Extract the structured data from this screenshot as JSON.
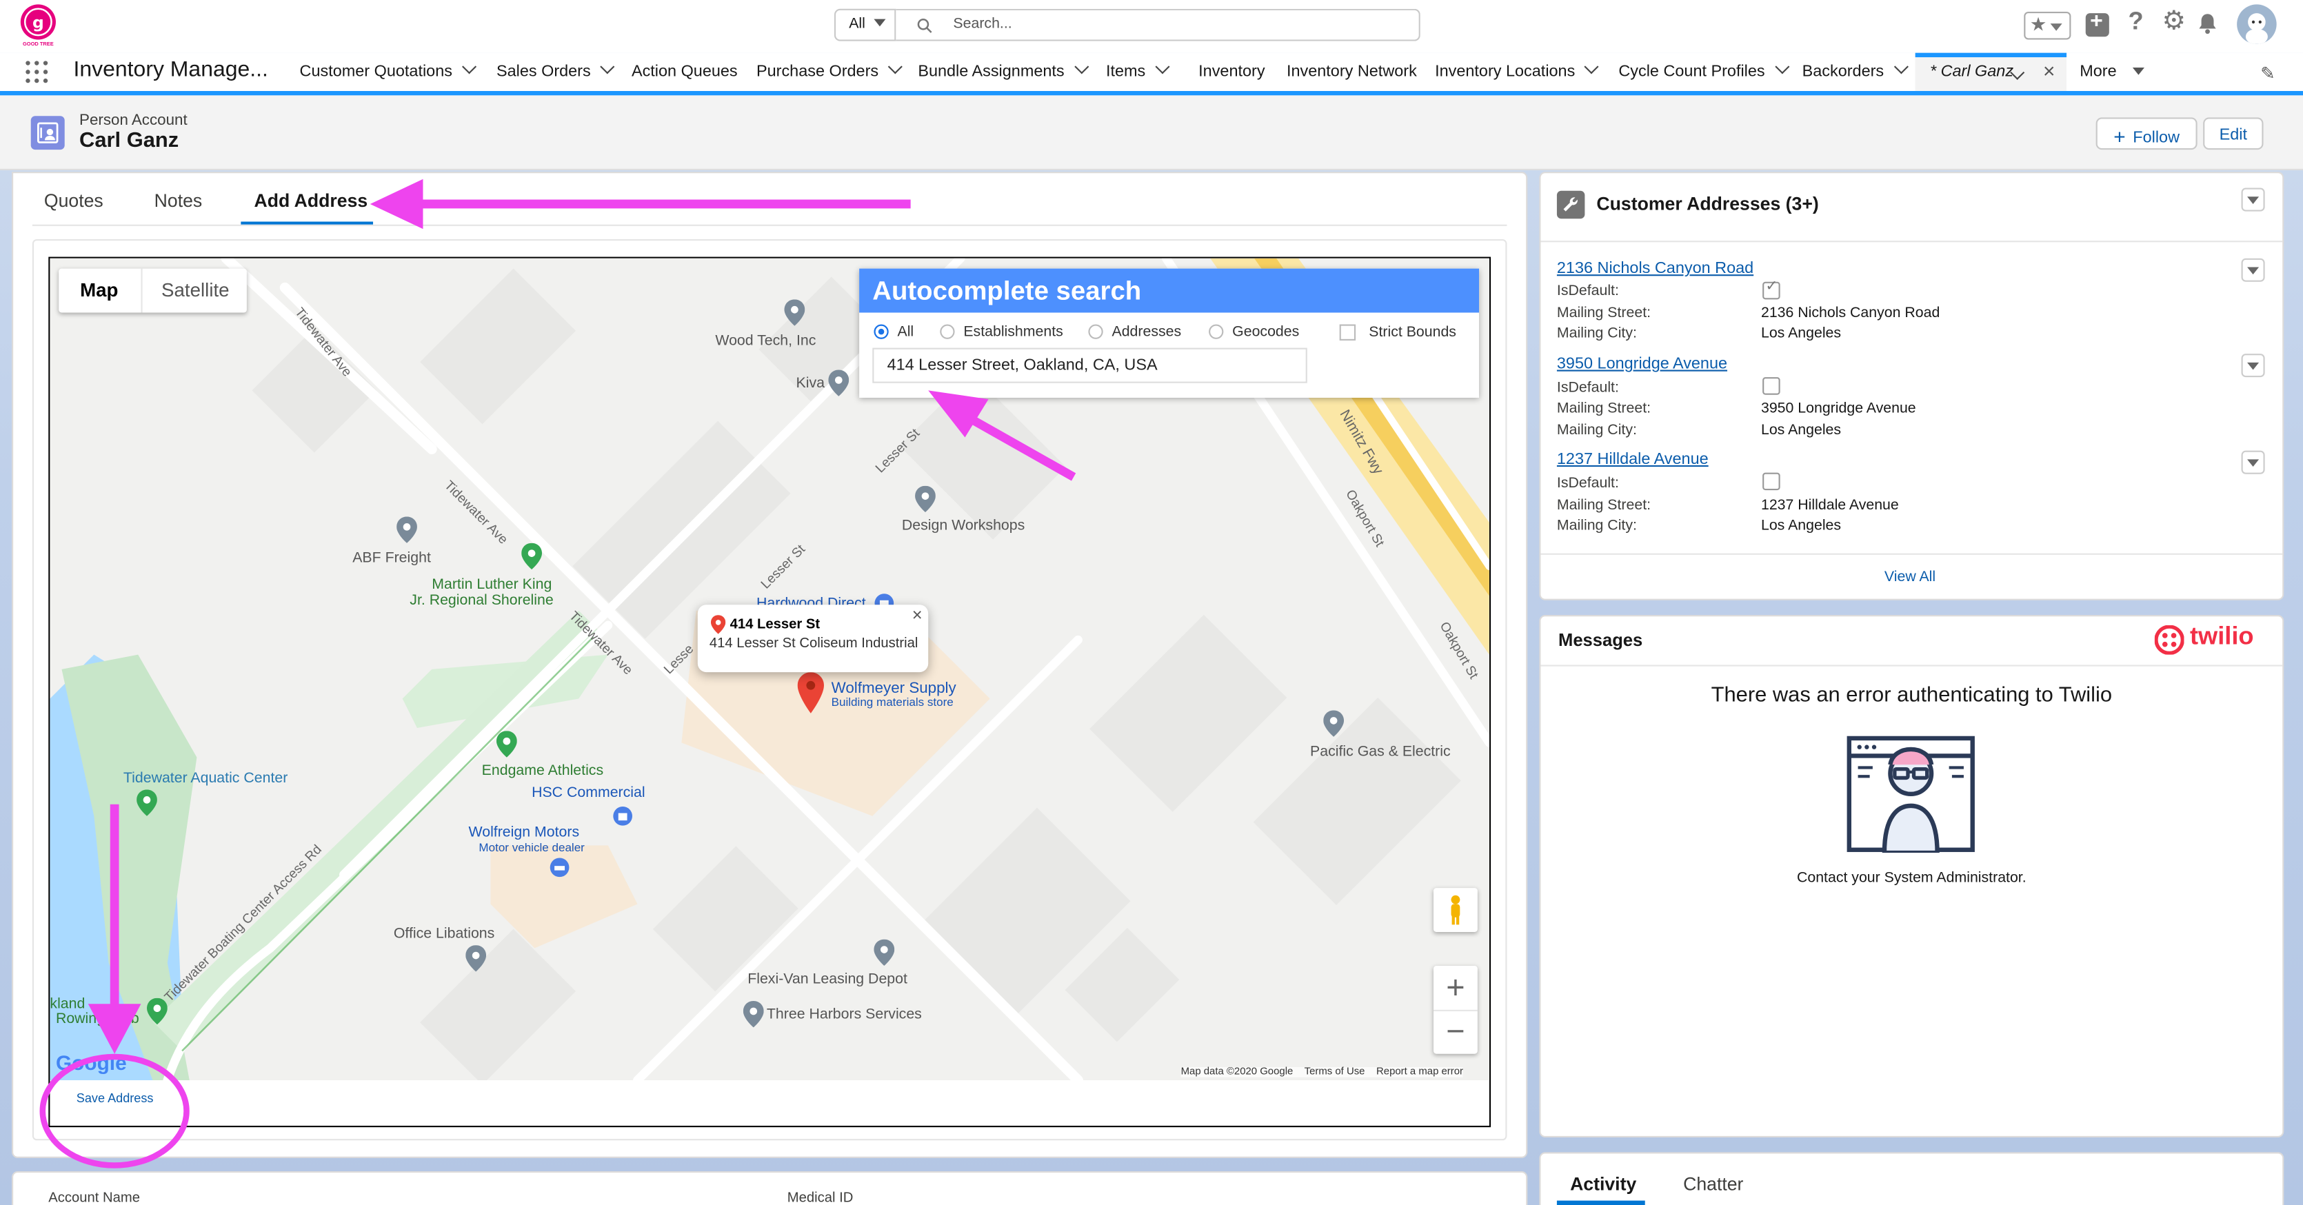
{
  "header": {
    "search_scope": "All",
    "search_placeholder": "Search...",
    "app_name": "Inventory Manage...",
    "logo_text": "GOOD TREE"
  },
  "nav": {
    "items": [
      {
        "label": "Customer Quotations",
        "dropdown": true
      },
      {
        "label": "Sales Orders",
        "dropdown": true
      },
      {
        "label": "Action Queues",
        "dropdown": false
      },
      {
        "label": "Purchase Orders",
        "dropdown": true
      },
      {
        "label": "Bundle Assignments",
        "dropdown": true
      },
      {
        "label": "Items",
        "dropdown": true
      },
      {
        "label": "Inventory",
        "dropdown": false
      },
      {
        "label": "Inventory Network",
        "dropdown": false
      },
      {
        "label": "Inventory Locations",
        "dropdown": true
      },
      {
        "label": "Cycle Count Profiles",
        "dropdown": true
      },
      {
        "label": "Backorders",
        "dropdown": true
      }
    ],
    "active_tab": "* Carl Ganz",
    "more": "More"
  },
  "record": {
    "object_type": "Person Account",
    "name": "Carl Ganz",
    "follow_label": "Follow",
    "edit_label": "Edit"
  },
  "tabs": {
    "quotes": "Quotes",
    "notes": "Notes",
    "add_address": "Add Address"
  },
  "map": {
    "map_btn": "Map",
    "satellite_btn": "Satellite",
    "autocomplete": {
      "title": "Autocomplete search",
      "options": [
        "All",
        "Establishments",
        "Addresses",
        "Geocodes"
      ],
      "selected": "All",
      "strict_bounds": "Strict Bounds",
      "value": "414 Lesser Street, Oakland, CA, USA"
    },
    "infowindow": {
      "title": "414 Lesser St",
      "subtitle": "414 Lesser St Coliseum Industrial"
    },
    "pois": {
      "wood_tech": "Wood Tech, Inc",
      "kiva": "Kiva",
      "design_workshops": "Design Workshops",
      "abf": "ABF Freight",
      "mlk": "Martin Luther King",
      "mlk2": "Jr. Regional Shoreline",
      "hardwood": "Hardwood Direct",
      "wolfmeyer": "Wolfmeyer Supply",
      "wolfmeyer_sub": "Building materials store",
      "pge": "Pacific Gas & Electric",
      "tidewater": "Tidewater Aquatic Center",
      "endgame": "Endgame Athletics",
      "hsc": "HSC Commercial",
      "wolfreign": "Wolfreign Motors",
      "wolfreign_sub": "Motor vehicle dealer",
      "office": "Office Libations",
      "flexivan": "Flexi-Van Leasing Depot",
      "three_harbors": "Three Harbors Services",
      "kland": "kland",
      "rowing": "Rowing Club"
    },
    "streets": {
      "tidewater1": "Tidewater Ave",
      "tidewater2": "Tidewater Ave",
      "tidewater3": "Tidewater Ave",
      "lesser1": "Lesser St",
      "lesser2": "Lesser St",
      "lesser3": "Lesse",
      "nimitz": "Nimitz Fwy",
      "oakport1": "Oakport St",
      "oakport2": "Oakport St",
      "boating": "Tidewater Boating Center Access Rd"
    },
    "footer": {
      "data": "Map data ©2020 Google",
      "terms": "Terms of Use",
      "report": "Report a map error"
    },
    "google": "Google"
  },
  "save_address": "Save Address",
  "bottom_fields": {
    "account_name": "Account Name",
    "medical_id": "Medical ID"
  },
  "addresses": {
    "title": "Customer Addresses (3+)",
    "field_labels": {
      "is_default": "IsDefault:",
      "street": "Mailing Street:",
      "city": "Mailing City:"
    },
    "items": [
      {
        "name": "2136 Nichols Canyon Road",
        "is_default": true,
        "street": "2136 Nichols Canyon Road",
        "city": "Los Angeles"
      },
      {
        "name": "3950 Longridge Avenue",
        "is_default": false,
        "street": "3950 Longridge Avenue",
        "city": "Los Angeles"
      },
      {
        "name": "1237 Hilldale Avenue",
        "is_default": false,
        "street": "1237 Hilldale Avenue",
        "city": "Los Angeles"
      }
    ],
    "view_all": "View All"
  },
  "messages": {
    "title": "Messages",
    "brand": "twilio",
    "error": "There was an error authenticating to Twilio",
    "contact": "Contact your System Administrator."
  },
  "activity": {
    "activity_tab": "Activity",
    "chatter_tab": "Chatter"
  },
  "colors": {
    "brand_blue": "#1b96ff",
    "link": "#0b5cab",
    "annotation": "#ee44ee",
    "twilio": "#f22f46"
  }
}
